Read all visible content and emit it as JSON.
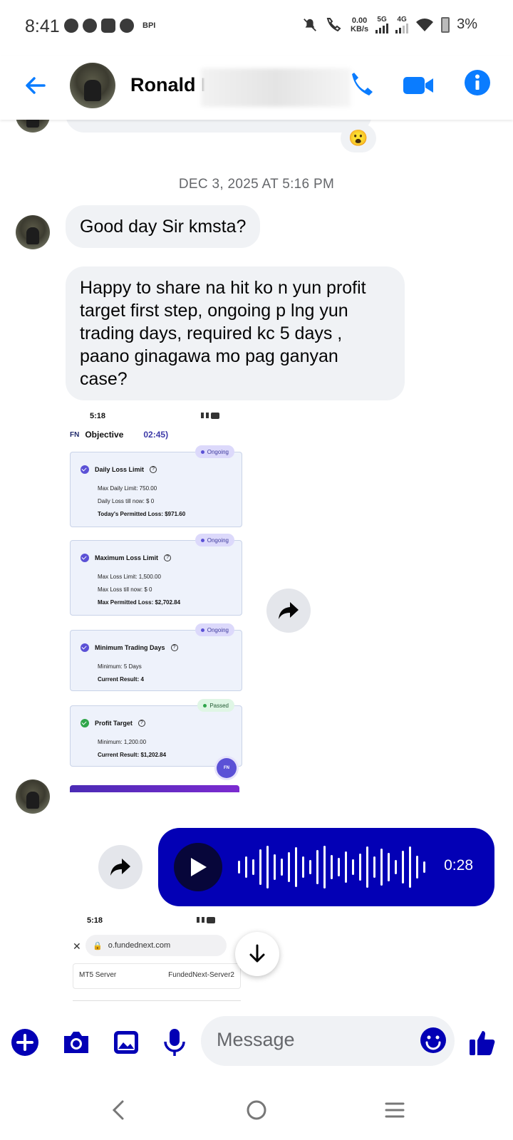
{
  "status_bar": {
    "time": "8:41",
    "carrier": "BPI",
    "net_rate_top": "0.00",
    "net_rate_bottom": "KB/s",
    "sig1": "5G",
    "sig2": "4G",
    "battery": "3%",
    "icons": [
      "messenger-icon",
      "chat-icon",
      "app-icon",
      "facebook-icon",
      "mute-icon",
      "wifi-call-icon",
      "signal-icon",
      "wifi-icon",
      "battery-icon"
    ]
  },
  "header": {
    "contact_name": "Ronald I",
    "icons": [
      "back-arrow-icon",
      "phone-icon",
      "video-camera-icon",
      "info-icon"
    ],
    "accent": "#0a7cff"
  },
  "messages": {
    "partial_reaction": "😮",
    "timestamp": "DEC 3, 2025 AT 5:16 PM",
    "msg1": "Good day Sir kmsta?",
    "msg2": "Happy to share na hit ko n yun profit target first step, ongoing p lng yun trading days, required kc 5 days , paano ginagawa mo pag ganyan case?"
  },
  "screenshot1": {
    "time": "5:18",
    "logo": "FN",
    "title": "Objective",
    "timer": "02:45)",
    "cards": [
      {
        "badge": "Ongoing",
        "title": "Daily Loss Limit",
        "lines": [
          "Max Daily Limit: 750.00",
          "Daily Loss till now: $ 0"
        ],
        "bold_line": "Today's Permitted Loss: $971.60"
      },
      {
        "badge": "Ongoing",
        "title": "Maximum Loss Limit",
        "lines": [
          "Max Loss Limit: 1,500.00",
          "Max Loss till now: $ 0"
        ],
        "bold_line": "Max Permitted Loss: $2,702.84"
      },
      {
        "badge": "Ongoing",
        "title": "Minimum Trading Days",
        "lines": [
          "Minimum: 5 Days"
        ],
        "bold_line": "Current Result: 4"
      },
      {
        "badge": "Passed",
        "title": "Profit Target",
        "lines": [
          "Minimum: 1,200.00"
        ],
        "bold_line": "Current Result: $1,202.84"
      }
    ],
    "fab": "FN"
  },
  "voice_message": {
    "duration": "0:28",
    "bubble_color": "#0300b5"
  },
  "screenshot2": {
    "time": "5:18",
    "url": "o.fundednext.com",
    "row_label": "MT5 Server",
    "row_value": "FundedNext-Server2"
  },
  "composer": {
    "placeholder": "Message",
    "icons": [
      "plus-icon",
      "camera-icon",
      "gallery-icon",
      "microphone-icon",
      "emoji-icon",
      "thumbs-up-icon"
    ]
  },
  "navbar": {
    "icons": [
      "nav-back-icon",
      "nav-home-icon",
      "nav-recents-icon"
    ]
  }
}
